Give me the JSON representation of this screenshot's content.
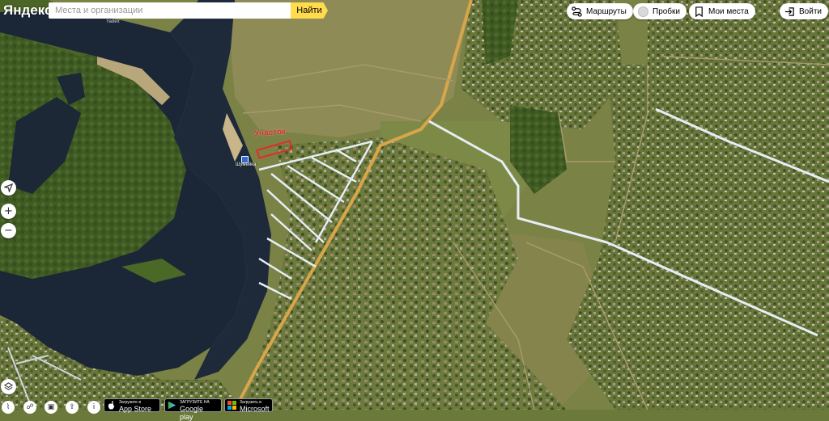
{
  "header": {
    "logo": "Яндекс",
    "search_placeholder": "Места и организации",
    "search_value": "",
    "find_label": "Найти",
    "routes_label": "Маршруты",
    "traffic_label": "Пробки",
    "places_label": "Мои места",
    "login_label": "Войти"
  },
  "map": {
    "plot_label": "Участок",
    "stop_label": "Шумейка",
    "tiny_watermark": "Yadex"
  },
  "controls": {
    "locate_icon": "locate-icon",
    "zoom_in_label": "+",
    "zoom_out_label": "−",
    "layers_icon": "layers-icon"
  },
  "badges": {
    "appstore_small": "Загрузите в",
    "appstore_big": "App Store",
    "googleplay_small": "ЗАГРУЗИТЕ НА",
    "googleplay_big": "Google play",
    "microsoft_small": "Загрузить в",
    "microsoft_big": "Microsoft"
  },
  "colors": {
    "accent": "#ffdb4d",
    "river": "#1b2636",
    "forest": "#3f5a22",
    "field": "#8a8a4c",
    "roads": "#e6eef5",
    "dirt_road": "#d8a64a",
    "plot_outline": "#e32b2b"
  }
}
